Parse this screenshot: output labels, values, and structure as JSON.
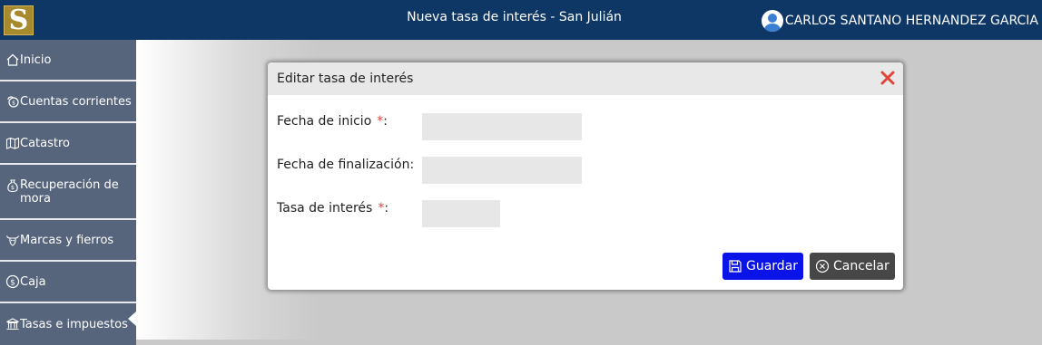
{
  "header": {
    "logo_letter": "S",
    "title": "Nueva tasa de interés - San Julián",
    "user_name": "CARLOS SANTANO HERNANDEZ GARCIA"
  },
  "sidebar": {
    "items": [
      {
        "label": "Inicio",
        "icon": "home-icon"
      },
      {
        "label": "Cuentas corrientes",
        "icon": "coins-icon"
      },
      {
        "label": "Catastro",
        "icon": "map-icon"
      },
      {
        "label": "Recuperación de mora",
        "icon": "money-bag-icon"
      },
      {
        "label": "Marcas y fierros",
        "icon": "cow-icon"
      },
      {
        "label": "Caja",
        "icon": "dollar-circle-icon"
      },
      {
        "label": "Tasas e impuestos",
        "icon": "bank-icon"
      }
    ],
    "active": "Tasas e impuestos"
  },
  "modal": {
    "title": "Editar tasa de interés",
    "fields": {
      "start_date": {
        "label": "Fecha de inicio",
        "required_mark": "*",
        "colon": ":",
        "value": ""
      },
      "end_date": {
        "label": "Fecha de finalización:",
        "value": ""
      },
      "interest_rate": {
        "label": "Tasa de interés",
        "required_mark": "*",
        "colon": ":",
        "value": ""
      }
    },
    "save_label": "Guardar",
    "cancel_label": "Cancelar"
  },
  "colors": {
    "topbar": "#0e3766",
    "sidebar": "#56647c",
    "save_button": "#0a14e8",
    "cancel_button": "#474747",
    "close_icon": "#e0453a"
  }
}
